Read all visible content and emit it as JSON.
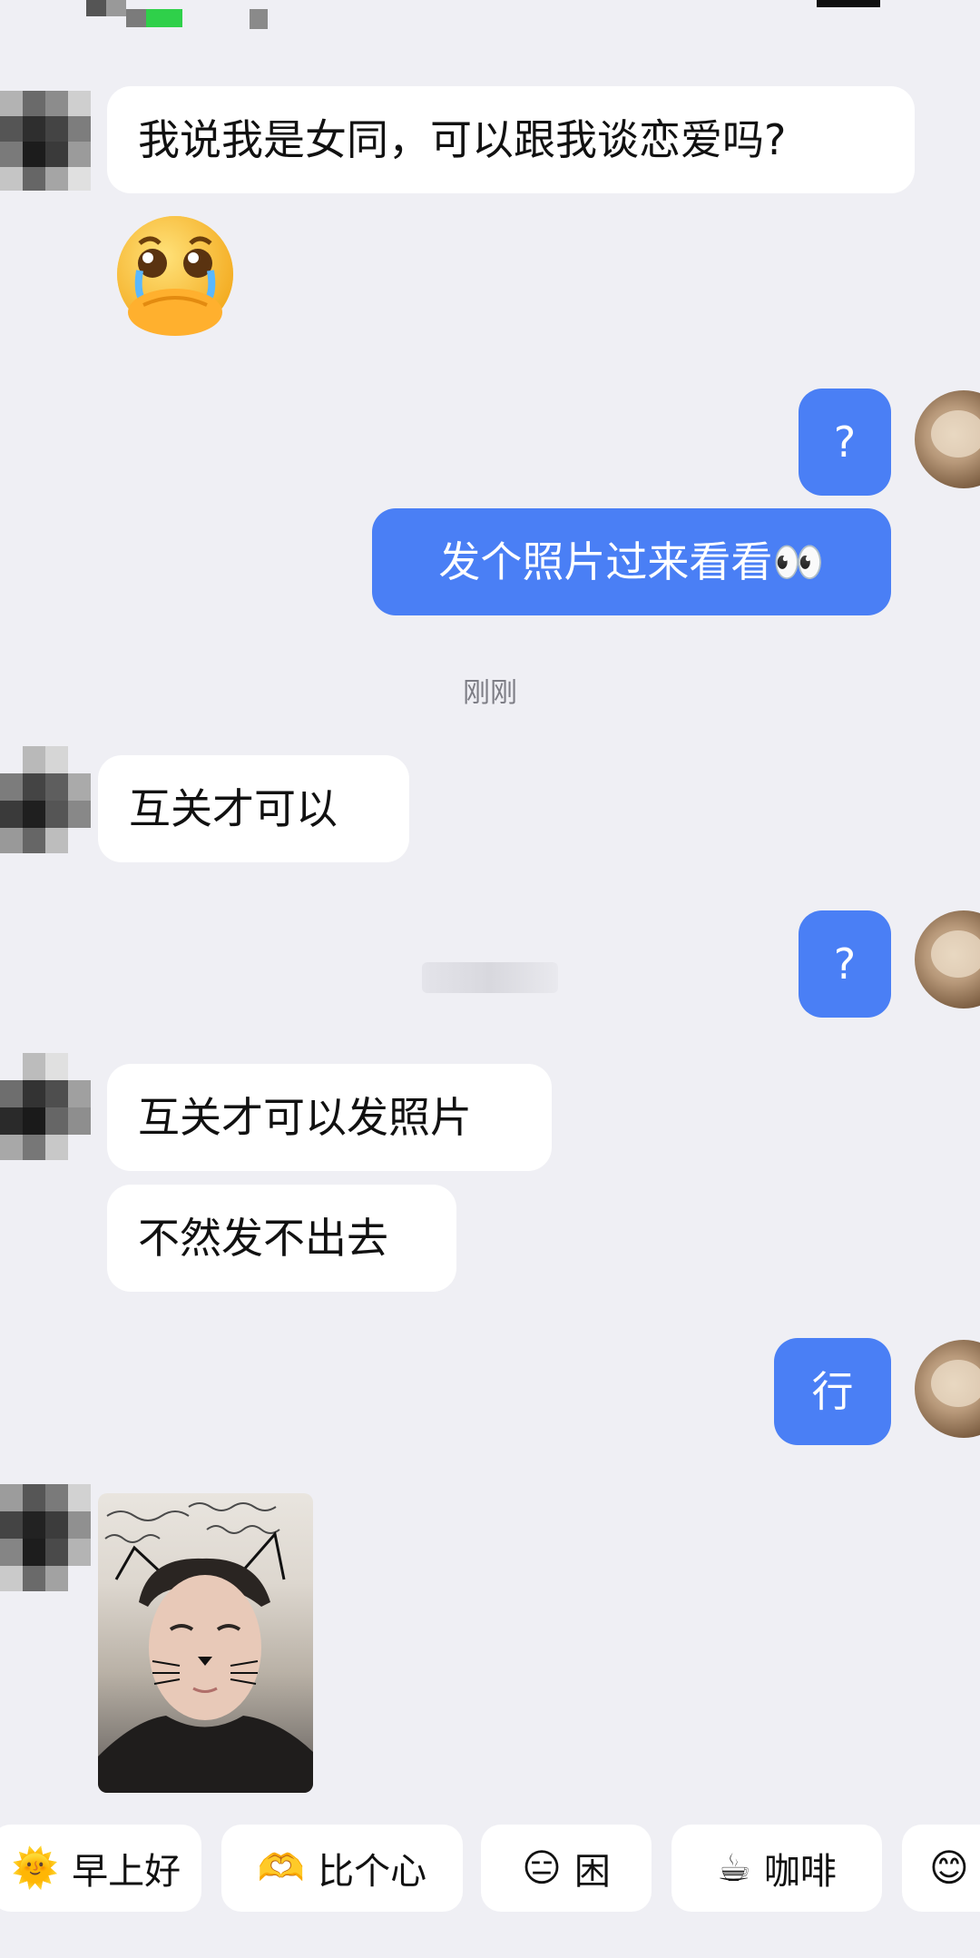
{
  "messages": {
    "m1": "我说我是女同，可以跟我谈恋爱吗?",
    "m2": "?",
    "m3": "发个照片过来看看👀",
    "m4": "互关才可以",
    "m5": "?",
    "m6": "互关才可以发照片",
    "m7": "不然发不出去",
    "m8": "行"
  },
  "timestamp": "刚刚",
  "quick_replies": [
    {
      "emoji": "🌞",
      "label": "早上好"
    },
    {
      "emoji": "🫶",
      "label": "比个心"
    },
    {
      "emoji": "😑",
      "label": "困"
    },
    {
      "emoji": "☕",
      "label": "咖啡"
    },
    {
      "emoji": "😊",
      "label": ""
    }
  ],
  "colors": {
    "outgoing_bubble": "#4a7ff5",
    "incoming_bubble": "#ffffff",
    "background": "#efeff4"
  }
}
